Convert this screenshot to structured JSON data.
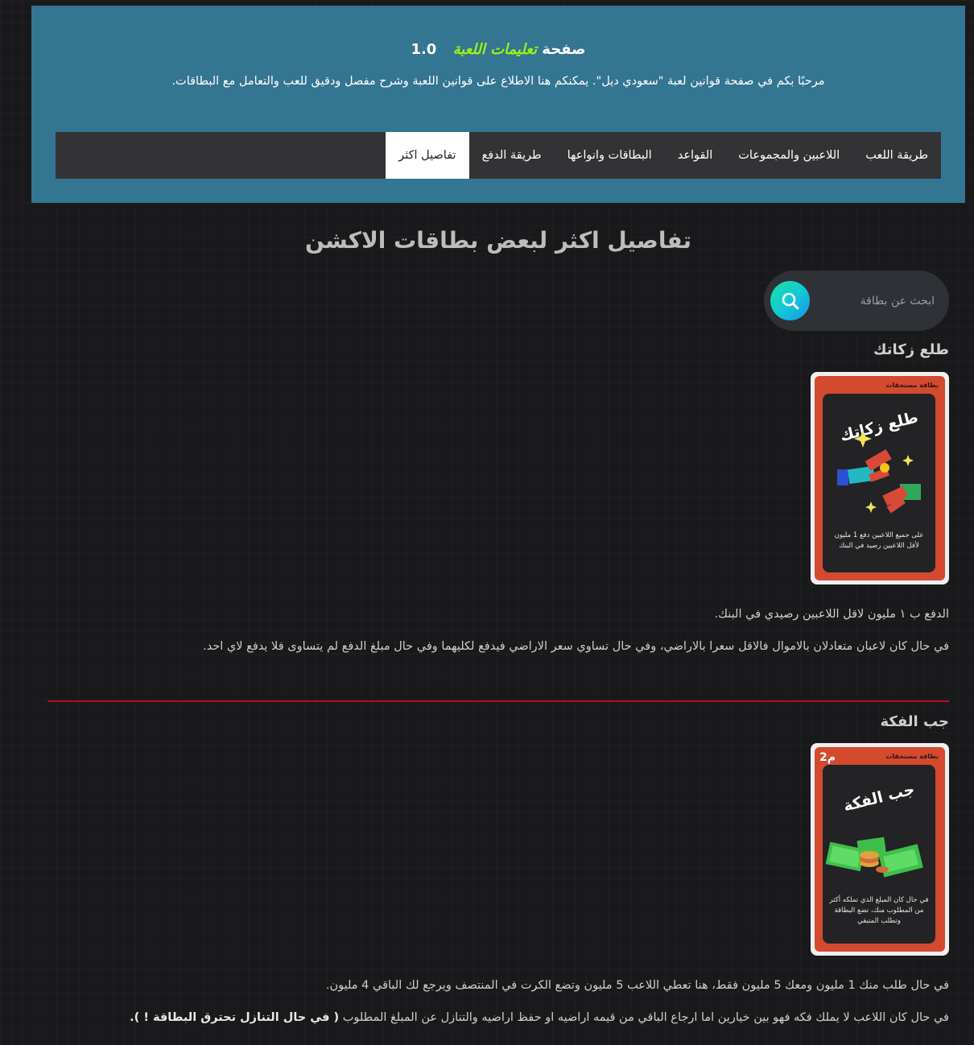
{
  "header": {
    "title_prefix": "صفحة",
    "title_accent": "تعليمات اللعبة",
    "version": "1.0",
    "welcome": "مرحبًا بكم في صفحة قوانين لعبة \"سعودي ديل\". يمكنكم هنا الاطلاع على قوانين اللعبة وشرح مفصل ودقيق للعب والتعامل مع البطاقات."
  },
  "nav": {
    "items": [
      {
        "label": "طريقة اللعب"
      },
      {
        "label": "اللاعبين والمجموعات"
      },
      {
        "label": "القواعد"
      },
      {
        "label": "البطاقات وانواعها"
      },
      {
        "label": "طريقة الدفع"
      },
      {
        "label": "تفاصيل اكثر"
      }
    ],
    "active_index": 5
  },
  "main": {
    "title": "تفاصيل اكثر لبعض بطاقات الاكشن"
  },
  "search": {
    "placeholder": "ابحث عن بطاقة",
    "icon": "search-icon"
  },
  "cards": [
    {
      "heading": "طلع زكاتك",
      "tag": "بطاقة مستحقات",
      "card_title": "طلع زكاتك",
      "card_desc": "على جميع اللاعبين دفع 1 مليون لأقل اللاعبين رصيد في البنك",
      "paragraphs": [
        "الدفع ب ١ مليون لاقل اللاعبين رصيدي في البنك.",
        "في حال كان لاعبان متعادلان بالاموال فالاقل سعرا بالاراضي، وفي حال تساوي سعر الاراضي فيدفع لكليهما وفي حال مبلغ الدفع لم يتساوى فلا يدفع لاي احد."
      ]
    },
    {
      "heading": "جب الفكة",
      "tag": "بطاقة مستحقات",
      "amount": "2م",
      "card_title": "جب الفكة",
      "card_desc": "في حال كان المبلغ الذي تملكه أكثر من المطلوب منك، تضع البطاقة وتطلب المتبقي",
      "paragraphs": [
        "في حال طلب منك 1 مليون ومعك 5 مليون فقط، هنا تعطي اللاعب 5 مليون وتضع الكرت في المنتصف ويرجع لك الباقي 4 مليون.",
        "في حال كان اللاعب لا يملك فكه فهو بين خيارين اما ارجاع الباقي من قيمه اراضيه او حفظ اراضيه والتنازل عن المبلغ المطلوب"
      ],
      "bold_note": "( في حال التنازل تحترق البطاقة ! )."
    }
  ],
  "colors": {
    "header_bg": "#347591",
    "accent_green": "#9ef01a",
    "divider_red": "#b5101a",
    "card_red": "#d34a2f",
    "search_gradient_start": "#19e3a2",
    "search_gradient_end": "#1a8fe8"
  }
}
